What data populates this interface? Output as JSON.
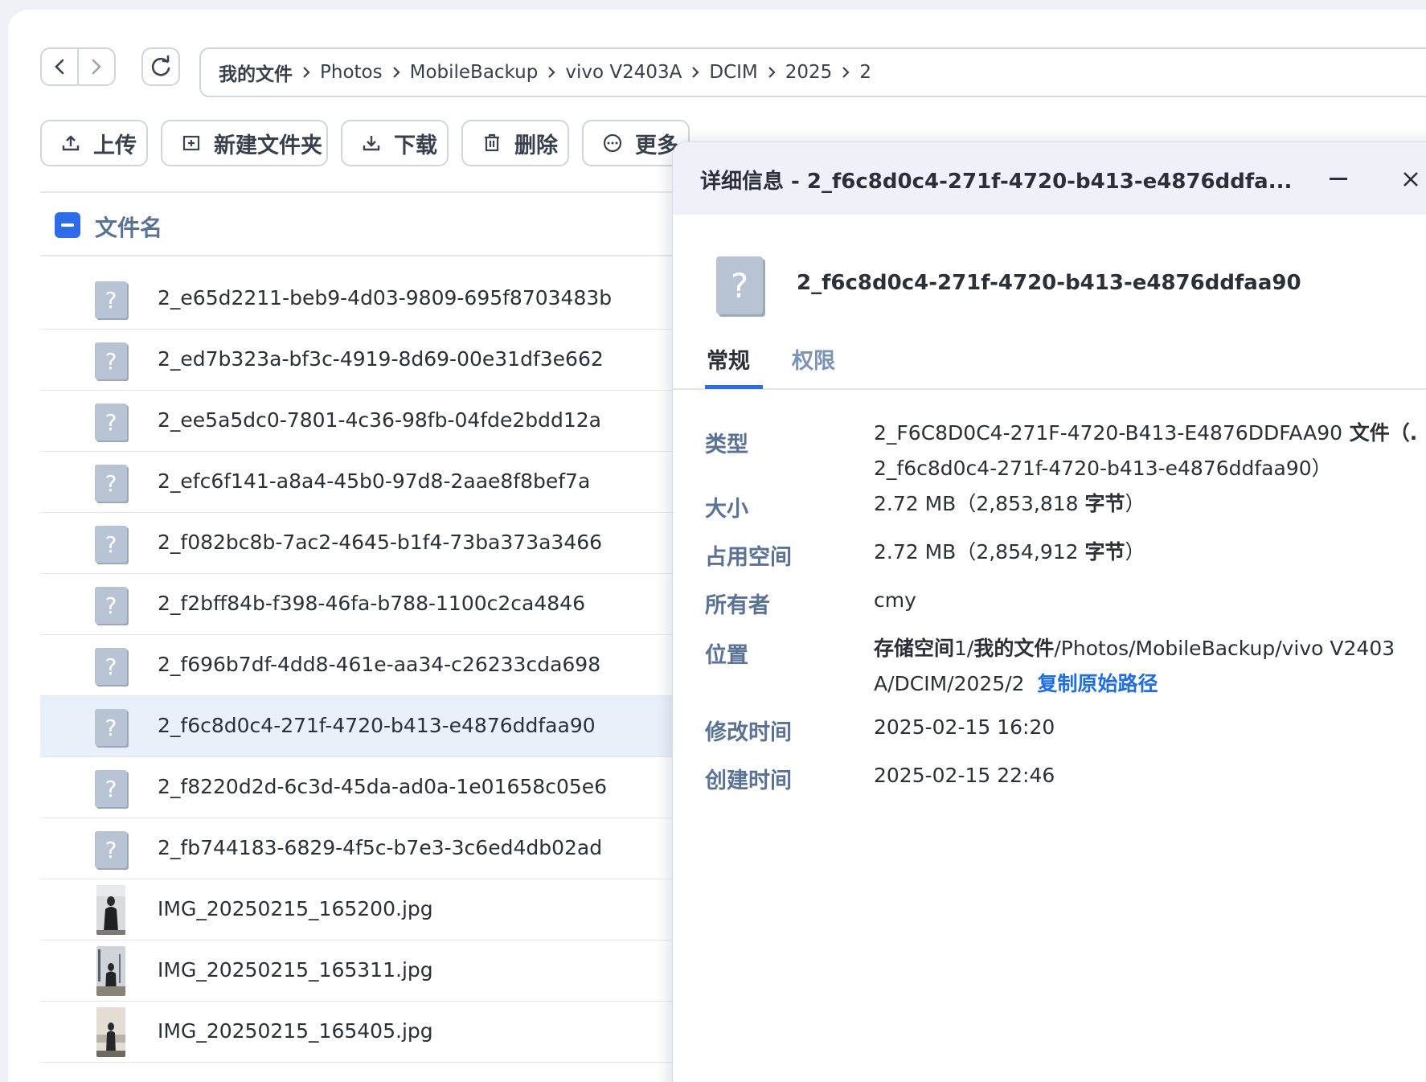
{
  "breadcrumb": [
    "我的文件",
    "Photos",
    "MobileBackup",
    "vivo V2403A",
    "DCIM",
    "2025",
    "2"
  ],
  "toolbar": {
    "upload": "上传",
    "new_folder": "新建文件夹",
    "download": "下载",
    "delete": "删除",
    "more": "更多"
  },
  "file_list": {
    "column_header": "文件名",
    "rows": [
      {
        "name": "2_e65d2211-beb9-4d03-9809-695f8703483b",
        "icon": "unknown-file-icon"
      },
      {
        "name": "2_ed7b323a-bf3c-4919-8d69-00e31df3e662",
        "icon": "unknown-file-icon"
      },
      {
        "name": "2_ee5a5dc0-7801-4c36-98fb-04fde2bdd12a",
        "icon": "unknown-file-icon"
      },
      {
        "name": "2_efc6f141-a8a4-45b0-97d8-2aae8f8bef7a",
        "icon": "unknown-file-icon"
      },
      {
        "name": "2_f082bc8b-7ac2-4645-b1f4-73ba373a3466",
        "icon": "unknown-file-icon"
      },
      {
        "name": "2_f2bff84b-f398-46fa-b788-1100c2ca4846",
        "icon": "unknown-file-icon"
      },
      {
        "name": "2_f696b7df-4dd8-461e-aa34-c26233cda698",
        "icon": "unknown-file-icon"
      },
      {
        "name": "2_f6c8d0c4-271f-4720-b413-e4876ddfaa90",
        "icon": "unknown-file-icon",
        "selected": true
      },
      {
        "name": "2_f8220d2d-6c3d-45da-ad0a-1e01658c05e6",
        "icon": "unknown-file-icon"
      },
      {
        "name": "2_fb744183-6829-4f5c-b7e3-3c6ed4db02ad",
        "icon": "unknown-file-icon"
      },
      {
        "name": "IMG_20250215_165200.jpg",
        "icon": "photo-thumbnail"
      },
      {
        "name": "IMG_20250215_165311.jpg",
        "icon": "photo-thumbnail"
      },
      {
        "name": "IMG_20250215_165405.jpg",
        "icon": "photo-thumbnail"
      }
    ]
  },
  "details": {
    "title": "详细信息 - 2_f6c8d0c4-271f-4720-b413-e4876ddfa...",
    "file_name": "2_f6c8d0c4-271f-4720-b413-e4876ddfaa90",
    "tabs": [
      "常规",
      "权限"
    ],
    "labels": {
      "type": "类型",
      "size": "大小",
      "occupied": "占用空间",
      "owner": "所有者",
      "location": "位置",
      "modified": "修改时间",
      "created": "创建时间"
    },
    "values": {
      "type_line1_a": "2_F6C8D0C4-271F-4720-B413-E4876DDFAA90",
      "type_line1_b": " 文件（.",
      "type_line2": "2_f6c8d0c4-271f-4720-b413-e4876ddfaa90）",
      "size_a": "2.72 MB（2,853,818 ",
      "size_b": "字节",
      "size_c": "）",
      "occupied_a": "2.72 MB（2,854,912 ",
      "occupied_b": "字节",
      "occupied_c": "）",
      "owner": "cmy",
      "location_bold1": "存储空间",
      "location_num": "1/",
      "location_bold2": "我的文件",
      "location_rest1": "/Photos/MobileBackup/vivo V2403",
      "location_rest2": "A/DCIM/2025/2",
      "copy_path": "复制原始路径",
      "modified": "2025-02-15 16:20",
      "created": "2025-02-15 22:46"
    }
  },
  "colors": {
    "accent": "#2d6ee8",
    "label": "#5a7296",
    "link": "#1f6fe0",
    "selected_row": "#eaf0fa"
  }
}
